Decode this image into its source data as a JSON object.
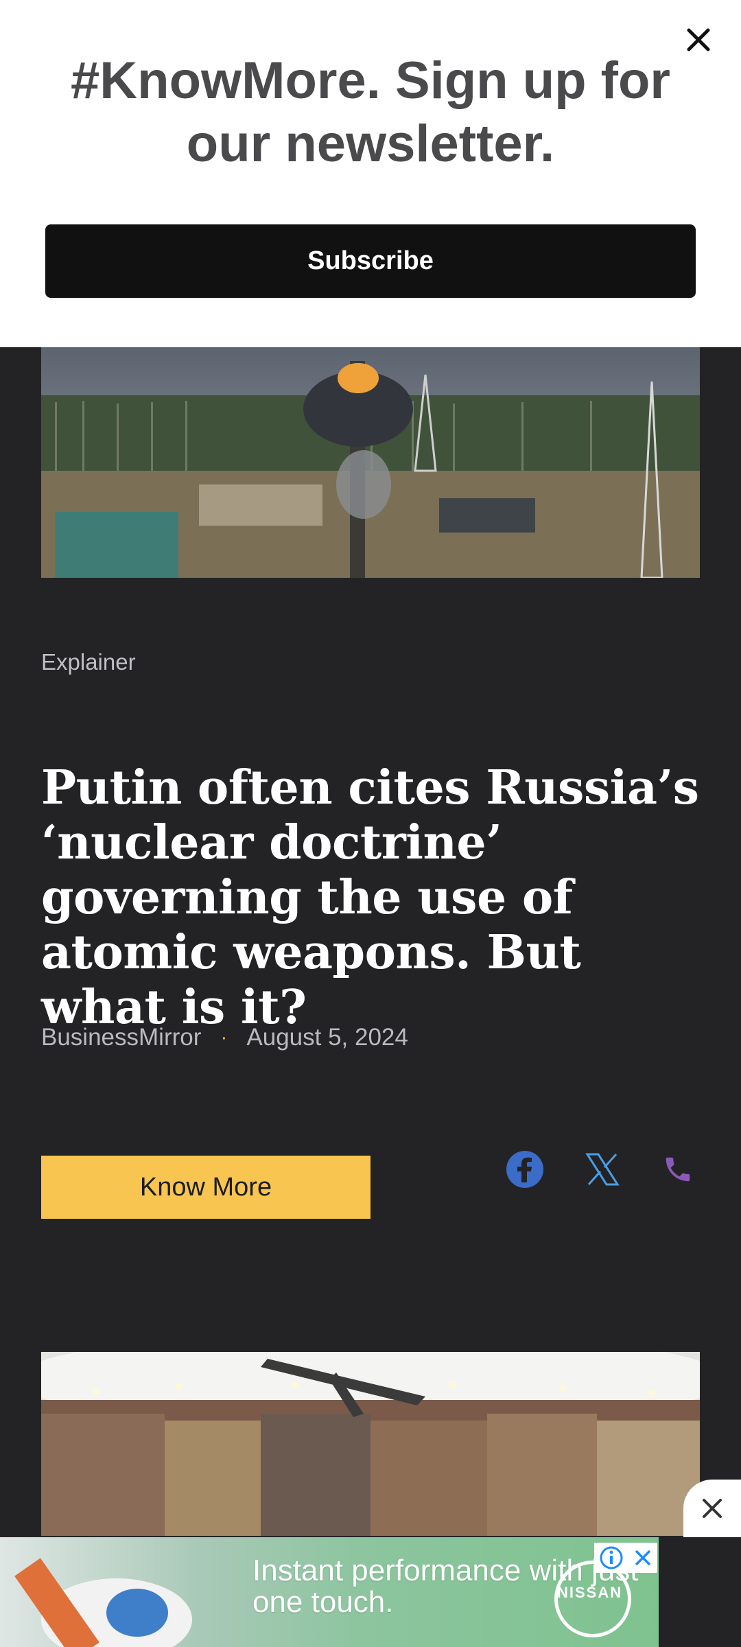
{
  "newsletter": {
    "title": "#KnowMore. Sign up for our newsletter.",
    "subscribe_label": "Subscribe",
    "close_icon": "close-icon"
  },
  "article": {
    "category": "Explainer",
    "headline": "Putin often cites Russia’s ‘nuclear doctrine’ governing the use of atomic weapons. But what is it?",
    "source": "BusinessMirror",
    "separator": "·",
    "date": "August 5, 2024",
    "know_more_label": "Know More",
    "share": [
      "facebook-icon",
      "x-icon",
      "phone-icon"
    ]
  },
  "ad": {
    "headline": "Instant performance with just one touch.",
    "brand": "NISSAN"
  },
  "colors": {
    "background": "#232325",
    "accent": "#f7c550",
    "facebook": "#3b6cc8",
    "x": "#4a9fe6",
    "phone": "#8a5ab8"
  }
}
